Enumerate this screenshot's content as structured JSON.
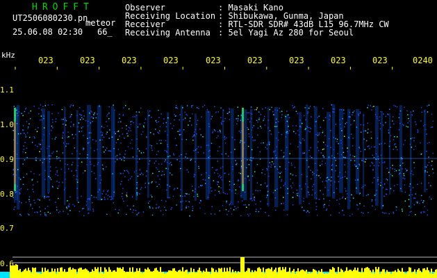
{
  "header": {
    "title": "HROFFT",
    "filename": "UT2506080230.pn_",
    "subtitle": "meteor",
    "datetime": "25.06.08 02:30",
    "number": "66_"
  },
  "info": [
    {
      "key": "Observer",
      "value": ": Masaki Kano"
    },
    {
      "key": "Receiving Location",
      "value": ": Shibukawa, Gunma, Japan"
    },
    {
      "key": "Receiver",
      "value": ": RTL-SDR SDR# 43dB L15 96.7MHz CW"
    },
    {
      "key": "Receiving Antenna",
      "value": ": 5el Yagi Az 280 for Seoul"
    }
  ],
  "axis": {
    "unit": "kHz",
    "x_ticks": [
      "023",
      "023",
      "023",
      "023",
      "023",
      "023",
      "023",
      "023",
      "023",
      "0240"
    ],
    "y_ticks": [
      "1.1",
      "1.0",
      "0.9",
      "0.8",
      "0.7",
      "0.6"
    ]
  },
  "colors": {
    "background": "#000000",
    "tick": "#ffff00",
    "title": "#00d800",
    "text": "#ffffff"
  }
}
